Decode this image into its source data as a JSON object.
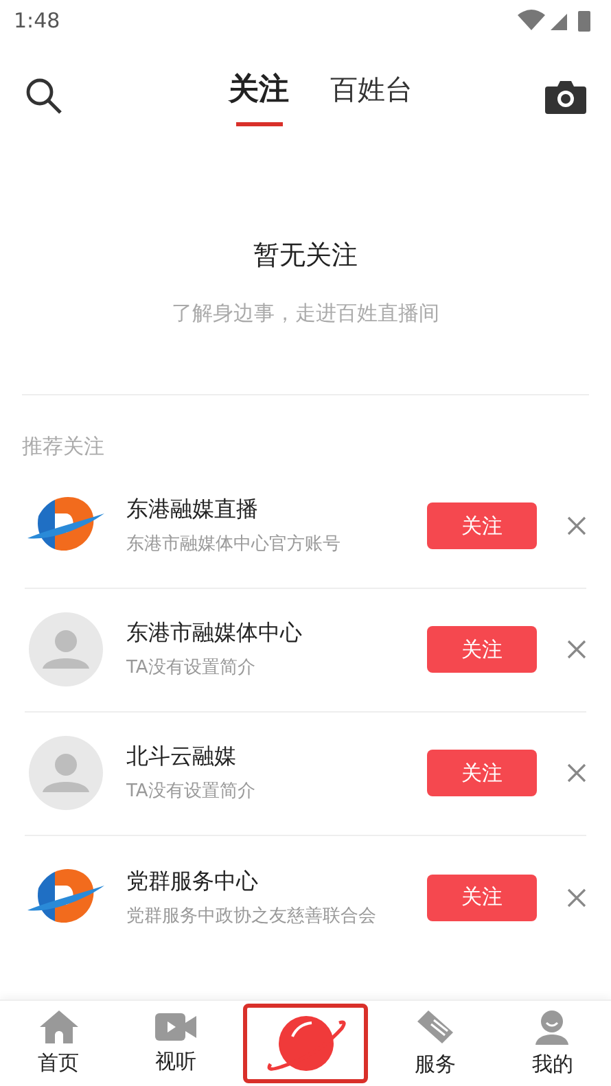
{
  "status_bar": {
    "time": "1:48"
  },
  "header": {
    "tabs": [
      {
        "label": "关注",
        "selected": true
      },
      {
        "label": "百姓台",
        "selected": false
      }
    ]
  },
  "empty_state": {
    "title": "暂无关注",
    "subtitle": "了解身边事，走进百姓直播间"
  },
  "recommend": {
    "heading": "推荐关注",
    "items": [
      {
        "name": "东港融媒直播",
        "desc": "东港市融媒体中心官方账号",
        "kind": "logo",
        "button": "关注"
      },
      {
        "name": "东港市融媒体中心",
        "desc": "TA没有设置简介",
        "kind": "default",
        "button": "关注"
      },
      {
        "name": "北斗云融媒",
        "desc": "TA没有设置简介",
        "kind": "default",
        "button": "关注"
      },
      {
        "name": "党群服务中心",
        "desc": "党群服务中政协之友慈善联合会",
        "kind": "logo",
        "button": "关注"
      }
    ]
  },
  "bottom_nav": [
    {
      "kind": "home",
      "label": "首页"
    },
    {
      "kind": "video",
      "label": "视听"
    },
    {
      "kind": "center"
    },
    {
      "kind": "service",
      "label": "服务"
    },
    {
      "kind": "me",
      "label": "我的"
    }
  ]
}
